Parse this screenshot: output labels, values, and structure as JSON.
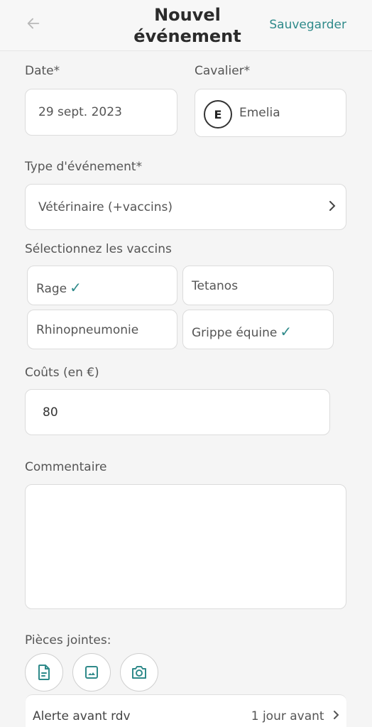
{
  "header": {
    "back_icon": "arrow-left-icon",
    "title": "Nouvel événement",
    "save_label": "Sauvegarder"
  },
  "form": {
    "date": {
      "label": "Date*",
      "value": "29 sept. 2023"
    },
    "rider": {
      "label": "Cavalier*",
      "initial": "E",
      "name": "Emelia"
    },
    "event_type": {
      "label": "Type d'événement*",
      "value": "Vétérinaire (+vaccins)"
    },
    "vaccines": {
      "label": "Sélectionnez les vaccins",
      "items": [
        {
          "label": "Rage",
          "selected": true
        },
        {
          "label": "Tetanos",
          "selected": false
        },
        {
          "label": "Rhinopneumonie",
          "selected": false
        },
        {
          "label": "Grippe équine",
          "selected": true
        }
      ]
    },
    "cost": {
      "label": "Coûts (en €)",
      "value": "80"
    },
    "comment": {
      "label": "Commentaire",
      "value": ""
    },
    "attachments": {
      "label": "Pièces jointes:",
      "buttons": [
        "document-icon",
        "image-icon",
        "camera-icon"
      ]
    },
    "alert": {
      "label": "Alerte avant rdv",
      "value": "1 jour avant"
    }
  },
  "colors": {
    "accent": "#2f8a8a"
  }
}
